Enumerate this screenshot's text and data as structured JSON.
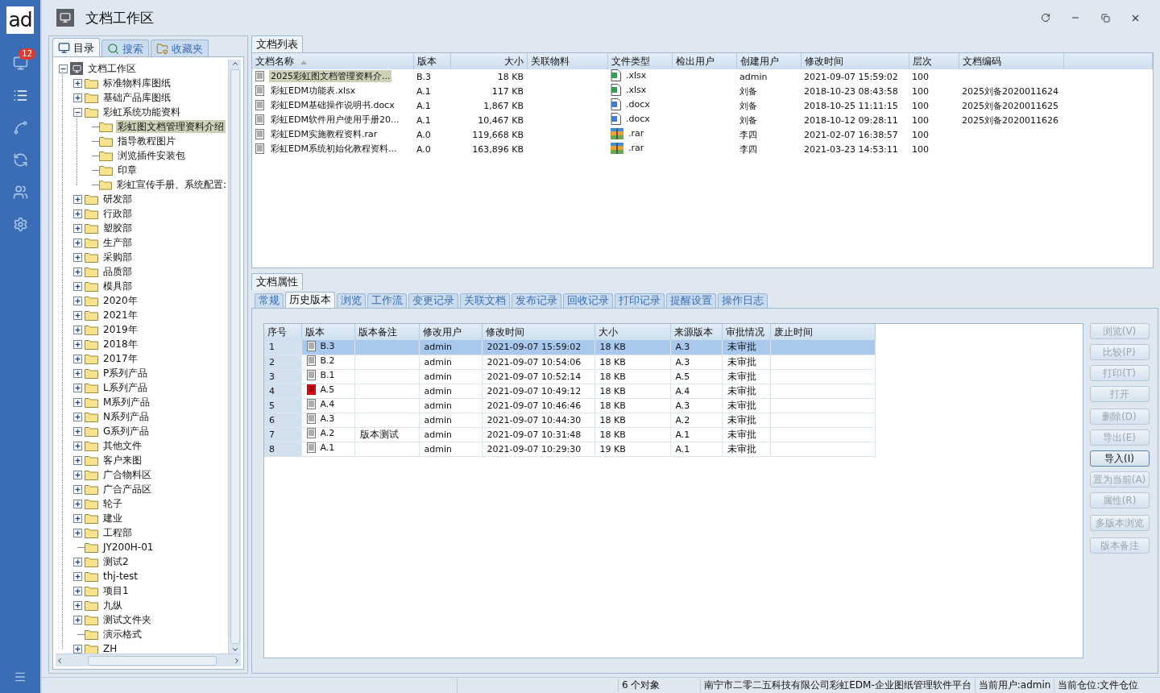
{
  "window": {
    "title": "文档工作区"
  },
  "sidebar": {
    "logo": "ad",
    "items": [
      {
        "kind": "monitor",
        "badge": "12",
        "selected": false
      },
      {
        "kind": "list",
        "selected": true
      },
      {
        "kind": "chart",
        "selected": false
      },
      {
        "kind": "sync",
        "selected": false
      },
      {
        "kind": "users",
        "selected": false
      },
      {
        "kind": "settings",
        "selected": false
      }
    ]
  },
  "left_tabs": [
    {
      "kind": "computer",
      "label": "目录",
      "selected": true
    },
    {
      "kind": "search",
      "label": "搜索",
      "selected": false
    },
    {
      "kind": "favorites",
      "label": "收藏夹",
      "selected": false
    }
  ],
  "tree": {
    "label": "文档工作区",
    "kind": "branch",
    "expanded": true,
    "selected": false,
    "children": [
      {
        "label": "标准物料库图纸",
        "kind": "branch",
        "expanded": false,
        "selected": false
      },
      {
        "label": "基础产品库图纸",
        "kind": "branch",
        "expanded": false,
        "selected": false
      },
      {
        "label": "彩虹系统功能资料",
        "kind": "branch",
        "expanded": true,
        "selected": false,
        "children": [
          {
            "label": "彩虹图文档管理资料介绍",
            "kind": "leaf",
            "selected": true
          },
          {
            "label": "指导教程图片",
            "kind": "leaf",
            "selected": false
          },
          {
            "label": "浏览插件安装包",
            "kind": "leaf",
            "selected": false
          },
          {
            "label": "印章",
            "kind": "leaf",
            "selected": false
          },
          {
            "label": "彩虹宣传手册、系统配置:",
            "kind": "leaf",
            "selected": false
          }
        ]
      },
      {
        "label": "研发部",
        "kind": "branch",
        "expanded": false,
        "selected": false
      },
      {
        "label": "行政部",
        "kind": "branch",
        "expanded": false,
        "selected": false
      },
      {
        "label": "塑胶部",
        "kind": "branch",
        "expanded": false,
        "selected": false
      },
      {
        "label": "生产部",
        "kind": "branch",
        "expanded": false,
        "selected": false
      },
      {
        "label": "采购部",
        "kind": "branch",
        "expanded": false,
        "selected": false
      },
      {
        "label": "品质部",
        "kind": "branch",
        "expanded": false,
        "selected": false
      },
      {
        "label": "模具部",
        "kind": "branch",
        "expanded": false,
        "selected": false
      },
      {
        "label": "2020年",
        "kind": "branch",
        "expanded": false,
        "selected": false
      },
      {
        "label": "2021年",
        "kind": "branch",
        "expanded": false,
        "selected": false
      },
      {
        "label": "2019年",
        "kind": "branch",
        "expanded": false,
        "selected": false
      },
      {
        "label": "2018年",
        "kind": "branch",
        "expanded": false,
        "selected": false
      },
      {
        "label": "2017年",
        "kind": "branch",
        "expanded": false,
        "selected": false
      },
      {
        "label": "P系列产品",
        "kind": "branch",
        "expanded": false,
        "selected": false
      },
      {
        "label": "L系列产品",
        "kind": "branch",
        "expanded": false,
        "selected": false
      },
      {
        "label": "M系列产品",
        "kind": "branch",
        "expanded": false,
        "selected": false
      },
      {
        "label": "N系列产品",
        "kind": "branch",
        "expanded": false,
        "selected": false
      },
      {
        "label": "G系列产品",
        "kind": "branch",
        "expanded": false,
        "selected": false
      },
      {
        "label": "其他文件",
        "kind": "branch",
        "expanded": false,
        "selected": false
      },
      {
        "label": "客户来图",
        "kind": "branch",
        "expanded": false,
        "selected": false
      },
      {
        "label": "广合物料区",
        "kind": "branch",
        "expanded": false,
        "selected": false
      },
      {
        "label": "广合产品区",
        "kind": "branch",
        "expanded": false,
        "selected": false
      },
      {
        "label": "轮子",
        "kind": "branch",
        "expanded": false,
        "selected": false
      },
      {
        "label": "建业",
        "kind": "branch",
        "expanded": false,
        "selected": false
      },
      {
        "label": "工程部",
        "kind": "branch",
        "expanded": false,
        "selected": false
      },
      {
        "label": "JY200H-01",
        "kind": "leaf",
        "selected": false
      },
      {
        "label": "测试2",
        "kind": "branch",
        "expanded": false,
        "selected": false
      },
      {
        "label": "thj-test",
        "kind": "branch",
        "expanded": false,
        "selected": false
      },
      {
        "label": "项目1",
        "kind": "branch",
        "expanded": false,
        "selected": false
      },
      {
        "label": "九纵",
        "kind": "branch",
        "expanded": false,
        "selected": false
      },
      {
        "label": "测试文件夹",
        "kind": "branch",
        "expanded": false,
        "selected": false
      },
      {
        "label": "演示格式",
        "kind": "leaf",
        "selected": false
      },
      {
        "label": "ZH",
        "kind": "branch",
        "expanded": false,
        "selected": false
      }
    ]
  },
  "file_list": {
    "title": "文档列表",
    "columns": [
      "文档名称",
      "版本",
      "大小",
      "关联物料",
      "文件类型",
      "检出用户",
      "创建用户",
      "修改时间",
      "层次",
      "文档编码"
    ],
    "rows": [
      {
        "selected": true,
        "name": "2025彩虹图文档管理资料介...",
        "version": "B.3",
        "size": "18 KB",
        "kind": "xlsx",
        "type": ".xlsx",
        "creator": "admin",
        "time": "2021-09-07 15:59:02",
        "level_text": "100"
      },
      {
        "selected": false,
        "name": "彩虹EDM功能表.xlsx",
        "version": "A.1",
        "size": "117 KB",
        "kind": "xlsx",
        "type": ".xlsx",
        "creator": "刘备",
        "time": "2018-10-23 08:43:58",
        "level_text": "100",
        "code": "2025刘备2020011624"
      },
      {
        "selected": false,
        "name": "彩虹EDM基础操作说明书.docx",
        "version": "A.1",
        "size": "1,867 KB",
        "kind": "docx",
        "type": ".docx",
        "creator": "刘备",
        "time": "2018-10-25 11:11:15",
        "level_text": "100",
        "code": "2025刘备2020011625"
      },
      {
        "selected": false,
        "name": "彩虹EDM软件用户使用手册20...",
        "version": "A.1",
        "size": "10,467 KB",
        "kind": "docx",
        "type": ".docx",
        "creator": "刘备",
        "time": "2018-10-12 09:28:11",
        "level_text": "100",
        "code": "2025刘备2020011626"
      },
      {
        "selected": false,
        "name": "彩虹EDM实施教程资料.rar",
        "version": "A.0",
        "size": "119,668 KB",
        "kind": "rar",
        "type": ".rar",
        "creator": "李四",
        "time": "2021-02-07 16:38:57",
        "level_text": "100"
      },
      {
        "selected": false,
        "name": "彩虹EDM系统初始化教程资料...",
        "version": "A.0",
        "size": "163,896 KB",
        "kind": "rar",
        "type": ".rar",
        "creator": "李四",
        "time": "2021-03-23 14:53:11",
        "level_text": "100"
      }
    ]
  },
  "properties": {
    "title": "文档属性",
    "tabs": [
      {
        "label": "常规",
        "selected": false
      },
      {
        "label": "历史版本",
        "selected": true
      },
      {
        "label": "浏览",
        "selected": false
      },
      {
        "label": "工作流",
        "selected": false
      },
      {
        "label": "变更记录",
        "selected": false
      },
      {
        "label": "关联文档",
        "selected": false
      },
      {
        "label": "发布记录",
        "selected": false
      },
      {
        "label": "回收记录",
        "selected": false
      },
      {
        "label": "打印记录",
        "selected": false
      },
      {
        "label": "提醒设置",
        "selected": false
      },
      {
        "label": "操作日志",
        "selected": false
      }
    ],
    "history": {
      "columns": [
        "序号",
        "版本",
        "版本备注",
        "修改用户",
        "修改时间",
        "大小",
        "来源版本",
        "审批情况",
        "废止时间"
      ],
      "rows": [
        {
          "selected": true,
          "seq": "1",
          "kind": "doc",
          "version": "B.3",
          "user": "admin",
          "time": "2021-09-07 15:59:02",
          "size": "18 KB",
          "source": "A.3",
          "approval": "未审批"
        },
        {
          "selected": false,
          "seq": "2",
          "kind": "doc",
          "version": "B.2",
          "user": "admin",
          "time": "2021-09-07 10:54:06",
          "size": "18 KB",
          "source": "A.3",
          "approval": "未审批"
        },
        {
          "selected": false,
          "seq": "3",
          "kind": "doc",
          "version": "B.1",
          "user": "admin",
          "time": "2021-09-07 10:52:14",
          "size": "18 KB",
          "source": "A.5",
          "approval": "未审批"
        },
        {
          "selected": false,
          "seq": "4",
          "kind": "flagged",
          "version": "A.5",
          "user": "admin",
          "time": "2021-09-07 10:49:12",
          "size": "18 KB",
          "source": "A.4",
          "approval": "未审批"
        },
        {
          "selected": false,
          "seq": "5",
          "kind": "doc",
          "version": "A.4",
          "user": "admin",
          "time": "2021-09-07 10:46:46",
          "size": "18 KB",
          "source": "A.3",
          "approval": "未审批"
        },
        {
          "selected": false,
          "seq": "6",
          "kind": "doc",
          "version": "A.3",
          "user": "admin",
          "time": "2021-09-07 10:44:30",
          "size": "18 KB",
          "source": "A.2",
          "approval": "未审批"
        },
        {
          "selected": false,
          "seq": "7",
          "kind": "doc",
          "version": "A.2",
          "note": "版本测试",
          "user": "admin",
          "time": "2021-09-07 10:31:48",
          "size": "18 KB",
          "source": "A.1",
          "approval": "未审批"
        },
        {
          "selected": false,
          "seq": "8",
          "kind": "doc",
          "version": "A.1",
          "user": "admin",
          "time": "2021-09-07 10:29:30",
          "size": "19 KB",
          "source": "A.1",
          "approval": "未审批"
        }
      ]
    },
    "action_groups": [
      [
        {
          "label": "浏览(V)",
          "disabled": true
        },
        {
          "label": "比较(P)",
          "disabled": true
        },
        {
          "label": "打印(T)",
          "disabled": true
        },
        {
          "label": "打开",
          "disabled": true
        }
      ],
      [
        {
          "label": "删除(D)",
          "disabled": true
        },
        {
          "label": "导出(E)",
          "disabled": true
        },
        {
          "label": "导入(I)",
          "disabled": false
        },
        {
          "label": "置为当前(A)",
          "disabled": true
        },
        {
          "label": "属性(R)",
          "disabled": true
        }
      ],
      [
        {
          "label": "多版本浏览",
          "disabled": true
        }
      ],
      [
        {
          "label": "版本备注",
          "disabled": true
        }
      ]
    ]
  },
  "status_bar": {
    "count": "6 个对象",
    "company": "南宁市二零二五科技有限公司彩虹EDM-企业图纸管理软件平台",
    "user": "当前用户:admin",
    "warehouse": "当前仓位:文件仓位"
  }
}
